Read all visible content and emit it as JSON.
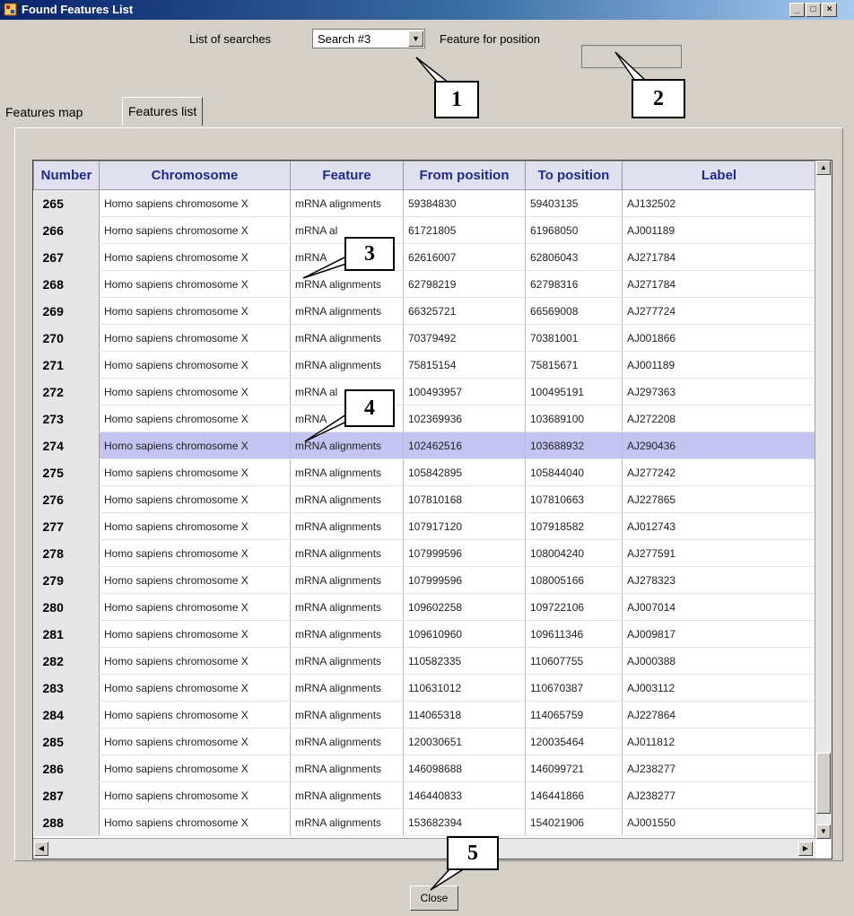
{
  "window": {
    "title": "Found Features List",
    "controls": [
      "_",
      "□",
      "×"
    ]
  },
  "search": {
    "list_label": "List of searches",
    "selected": "Search #3",
    "feature_label": "Feature for position",
    "feature_value": ""
  },
  "tabs": [
    {
      "label": "Features map",
      "active": false
    },
    {
      "label": "Features list",
      "active": true
    }
  ],
  "table": {
    "columns": [
      "Number",
      "Chromosome",
      "Feature",
      "From position",
      "To position",
      "Label"
    ],
    "selected_row": "274",
    "rows": [
      [
        "265",
        "Homo sapiens chromosome X",
        "mRNA alignments",
        "59384830",
        "59403135",
        "AJ132502"
      ],
      [
        "266",
        "Homo sapiens chromosome X",
        "mRNA al",
        "61721805",
        "61968050",
        "AJ001189"
      ],
      [
        "267",
        "Homo sapiens chromosome X",
        "mRNA",
        "62616007",
        "62806043",
        "AJ271784"
      ],
      [
        "268",
        "Homo sapiens chromosome X",
        "mRNA alignments",
        "62798219",
        "62798316",
        "AJ271784"
      ],
      [
        "269",
        "Homo sapiens chromosome X",
        "mRNA alignments",
        "66325721",
        "66569008",
        "AJ277724"
      ],
      [
        "270",
        "Homo sapiens chromosome X",
        "mRNA alignments",
        "70379492",
        "70381001",
        "AJ001866"
      ],
      [
        "271",
        "Homo sapiens chromosome X",
        "mRNA alignments",
        "75815154",
        "75815671",
        "AJ001189"
      ],
      [
        "272",
        "Homo sapiens chromosome X",
        "mRNA al",
        "100493957",
        "100495191",
        "AJ297363"
      ],
      [
        "273",
        "Homo sapiens chromosome X",
        "mRNA",
        "102369936",
        "103689100",
        "AJ272208"
      ],
      [
        "274",
        "Homo sapiens chromosome X",
        "mRNA alignments",
        "102462516",
        "103688932",
        "AJ290436"
      ],
      [
        "275",
        "Homo sapiens chromosome X",
        "mRNA alignments",
        "105842895",
        "105844040",
        "AJ277242"
      ],
      [
        "276",
        "Homo sapiens chromosome X",
        "mRNA alignments",
        "107810168",
        "107810663",
        "AJ227865"
      ],
      [
        "277",
        "Homo sapiens chromosome X",
        "mRNA alignments",
        "107917120",
        "107918582",
        "AJ012743"
      ],
      [
        "278",
        "Homo sapiens chromosome X",
        "mRNA alignments",
        "107999596",
        "108004240",
        "AJ277591"
      ],
      [
        "279",
        "Homo sapiens chromosome X",
        "mRNA alignments",
        "107999596",
        "108005166",
        "AJ278323"
      ],
      [
        "280",
        "Homo sapiens chromosome X",
        "mRNA alignments",
        "109602258",
        "109722106",
        "AJ007014"
      ],
      [
        "281",
        "Homo sapiens chromosome X",
        "mRNA alignments",
        "109610960",
        "109611346",
        "AJ009817"
      ],
      [
        "282",
        "Homo sapiens chromosome X",
        "mRNA alignments",
        "110582335",
        "110607755",
        "AJ000388"
      ],
      [
        "283",
        "Homo sapiens chromosome X",
        "mRNA alignments",
        "110631012",
        "110670387",
        "AJ003112"
      ],
      [
        "284",
        "Homo sapiens chromosome X",
        "mRNA alignments",
        "114065318",
        "114065759",
        "AJ227864"
      ],
      [
        "285",
        "Homo sapiens chromosome X",
        "mRNA alignments",
        "120030651",
        "120035464",
        "AJ011812"
      ],
      [
        "286",
        "Homo sapiens chromosome X",
        "mRNA alignments",
        "146098688",
        "146099721",
        "AJ238277"
      ],
      [
        "287",
        "Homo sapiens chromosome X",
        "mRNA alignments",
        "146440833",
        "146441866",
        "AJ238277"
      ],
      [
        "288",
        "Homo sapiens chromosome X",
        "mRNA alignments",
        "153682394",
        "154021906",
        "AJ001550"
      ]
    ]
  },
  "callouts": [
    "1",
    "2",
    "3",
    "4",
    "5"
  ],
  "close_label": "Close"
}
